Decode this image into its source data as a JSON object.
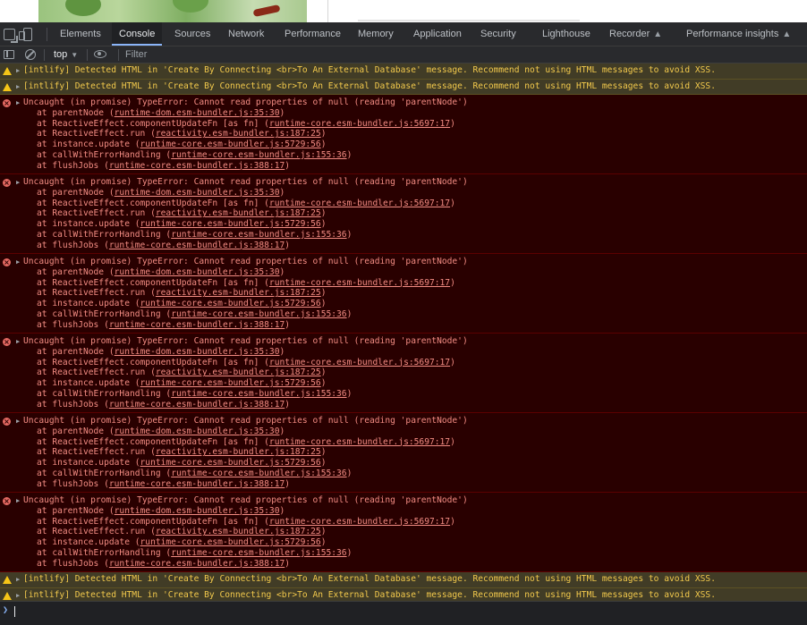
{
  "devtools": {
    "tabs": [
      {
        "label": "Elements"
      },
      {
        "label": "Console"
      },
      {
        "label": "Sources"
      },
      {
        "label": "Network"
      },
      {
        "label": "Performance"
      },
      {
        "label": "Memory"
      },
      {
        "label": "Application"
      },
      {
        "label": "Security"
      },
      {
        "label": "Lighthouse"
      },
      {
        "label": "Recorder"
      },
      {
        "label": "Performance insights"
      }
    ],
    "active_tab": "Console",
    "context": "top",
    "filter_placeholder": "Filter"
  },
  "console": {
    "warning_text": "[intlify] Detected HTML in 'Create By Connecting <br>To An External Database' message. Recommend not using HTML messages to avoid XSS.",
    "error_head": "Uncaught (in promise) TypeError: Cannot read properties of null (reading 'parentNode')",
    "frames": [
      {
        "prefix": "at parentNode (",
        "link": "runtime-dom.esm-bundler.js:35:30",
        "suffix": ")"
      },
      {
        "prefix": "at ReactiveEffect.componentUpdateFn [as fn] (",
        "link": "runtime-core.esm-bundler.js:5697:17",
        "suffix": ")"
      },
      {
        "prefix": "at ReactiveEffect.run (",
        "link": "reactivity.esm-bundler.js:187:25",
        "suffix": ")"
      },
      {
        "prefix": "at instance.update (",
        "link": "runtime-core.esm-bundler.js:5729:56",
        "suffix": ")"
      },
      {
        "prefix": "at callWithErrorHandling (",
        "link": "runtime-core.esm-bundler.js:155:36",
        "suffix": ")"
      },
      {
        "prefix": "at flushJobs (",
        "link": "runtime-core.esm-bundler.js:388:17",
        "suffix": ")"
      }
    ],
    "messages": [
      {
        "type": "warning"
      },
      {
        "type": "warning"
      },
      {
        "type": "error"
      },
      {
        "type": "error"
      },
      {
        "type": "error"
      },
      {
        "type": "error"
      },
      {
        "type": "error"
      },
      {
        "type": "error"
      },
      {
        "type": "warning"
      },
      {
        "type": "warning"
      }
    ]
  },
  "icons": {
    "inspect": "inspect-element-icon",
    "device": "device-toolbar-icon",
    "sidebar": "console-sidebar-icon",
    "clear": "clear-console-icon",
    "eye": "live-expression-icon",
    "warning": "warning-icon",
    "error": "error-icon",
    "flask": "experiment-icon"
  },
  "colors": {
    "warning_text": "#f2c94c",
    "warning_bg": "#413c26",
    "error_text": "#f28b82",
    "error_bg": "#290000",
    "active_tab_underline": "#8ab4f8"
  }
}
